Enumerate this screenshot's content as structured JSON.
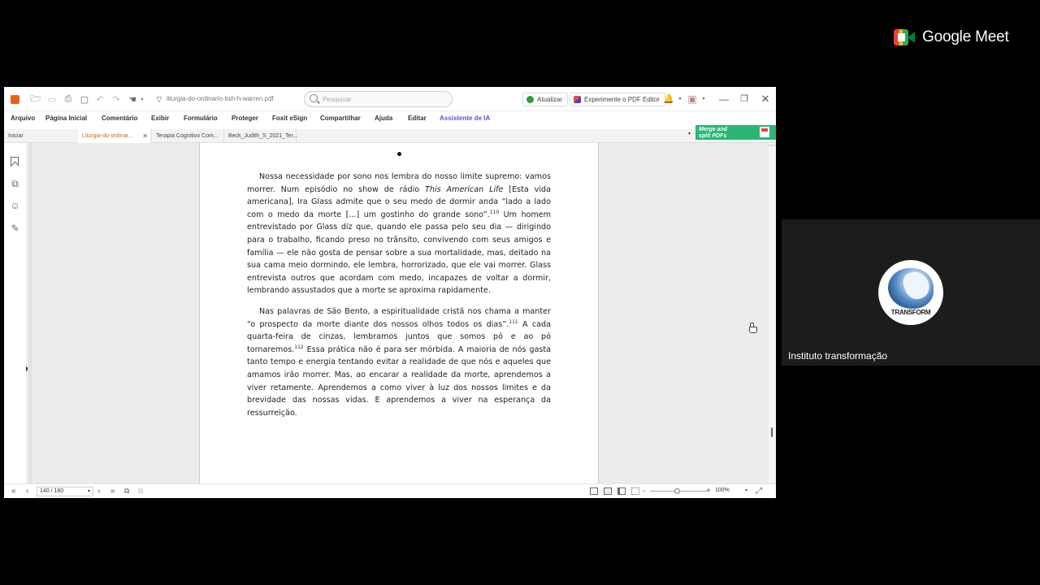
{
  "meet": {
    "brand": "Google Meet",
    "participant_name": "Instituto transformação",
    "avatar_text": "TRANSFORM"
  },
  "reader": {
    "titlebar": {
      "document_file": "liturgia-do-ordinario-tish-h-warren.pdf",
      "search_placeholder": "Pesquisar",
      "update_button": "Atualizar",
      "try_editor_button": "Experimente o PDF Editor"
    },
    "menu": [
      "Arquivo",
      "Página Inicial",
      "Comentário",
      "Exibir",
      "Formulário",
      "Proteger",
      "Foxit eSign",
      "Compartilhar",
      "Ajuda",
      "Editar",
      "Assistente de IA"
    ],
    "tabs": [
      {
        "label": "Iniciar"
      },
      {
        "label": "Liturgia-do-ordinar..."
      },
      {
        "label": "Terapia Cognitivo Com..."
      },
      {
        "label": "Beck_Judith_S_2021_Ter..."
      }
    ],
    "merge_banner": {
      "line1": "Merge and",
      "line2": "split PDFs"
    },
    "page_text": {
      "p1_a": "Nossa necessidade por sono nos lembra do nosso limite supremo: vamos morrer. Num episódio no show de rádio ",
      "p1_italic": "This American Life",
      "p1_b": " [Esta vida americana], Ira Glass admite que o seu medo de dormir anda “lado a lado com o medo da morte [...] um gostinho do grande sono”.",
      "p1_sup": "110",
      "p1_c": " Um homem entrevistado por Glass diz que, quando ele passa pelo seu dia — dirigindo para o trabalho, ficando preso no trânsito, convivendo com seus amigos e família — ele não gosta de pensar sobre a sua mortalidade, mas, deitado na sua cama meio dormindo, ele lembra, horrorizado, que ele vai morrer. Glass entrevista outros que acordam com medo, incapazes de voltar a dormir, lembrando assustados que a morte se aproxima rapidamente.",
      "p2_a": "Nas palavras de São Bento, a espiritualidade cristã nos chama a manter “o prospecto da morte diante dos nossos olhos todos os dias”.",
      "p2_sup1": "111",
      "p2_b": " A cada quarta-feira de cinzas, lembramos juntos que somos pó e ao pó tornaremos.",
      "p2_sup2": "112",
      "p2_c": " Essa prática não é para ser mórbida. A maioria de nós gasta tanto tempo e energia tentando evitar a realidade de que nós e aqueles que amamos irão morrer. Mas, ao encarar a realidade da morte, aprendemos a viver retamente. Aprendemos a como viver à luz dos nossos limites e da brevidade das nossas vidas. E aprendemos a viver na esperança da ressurreição."
    },
    "status": {
      "page_indicator": "140 / 160",
      "zoom": "100%"
    }
  }
}
